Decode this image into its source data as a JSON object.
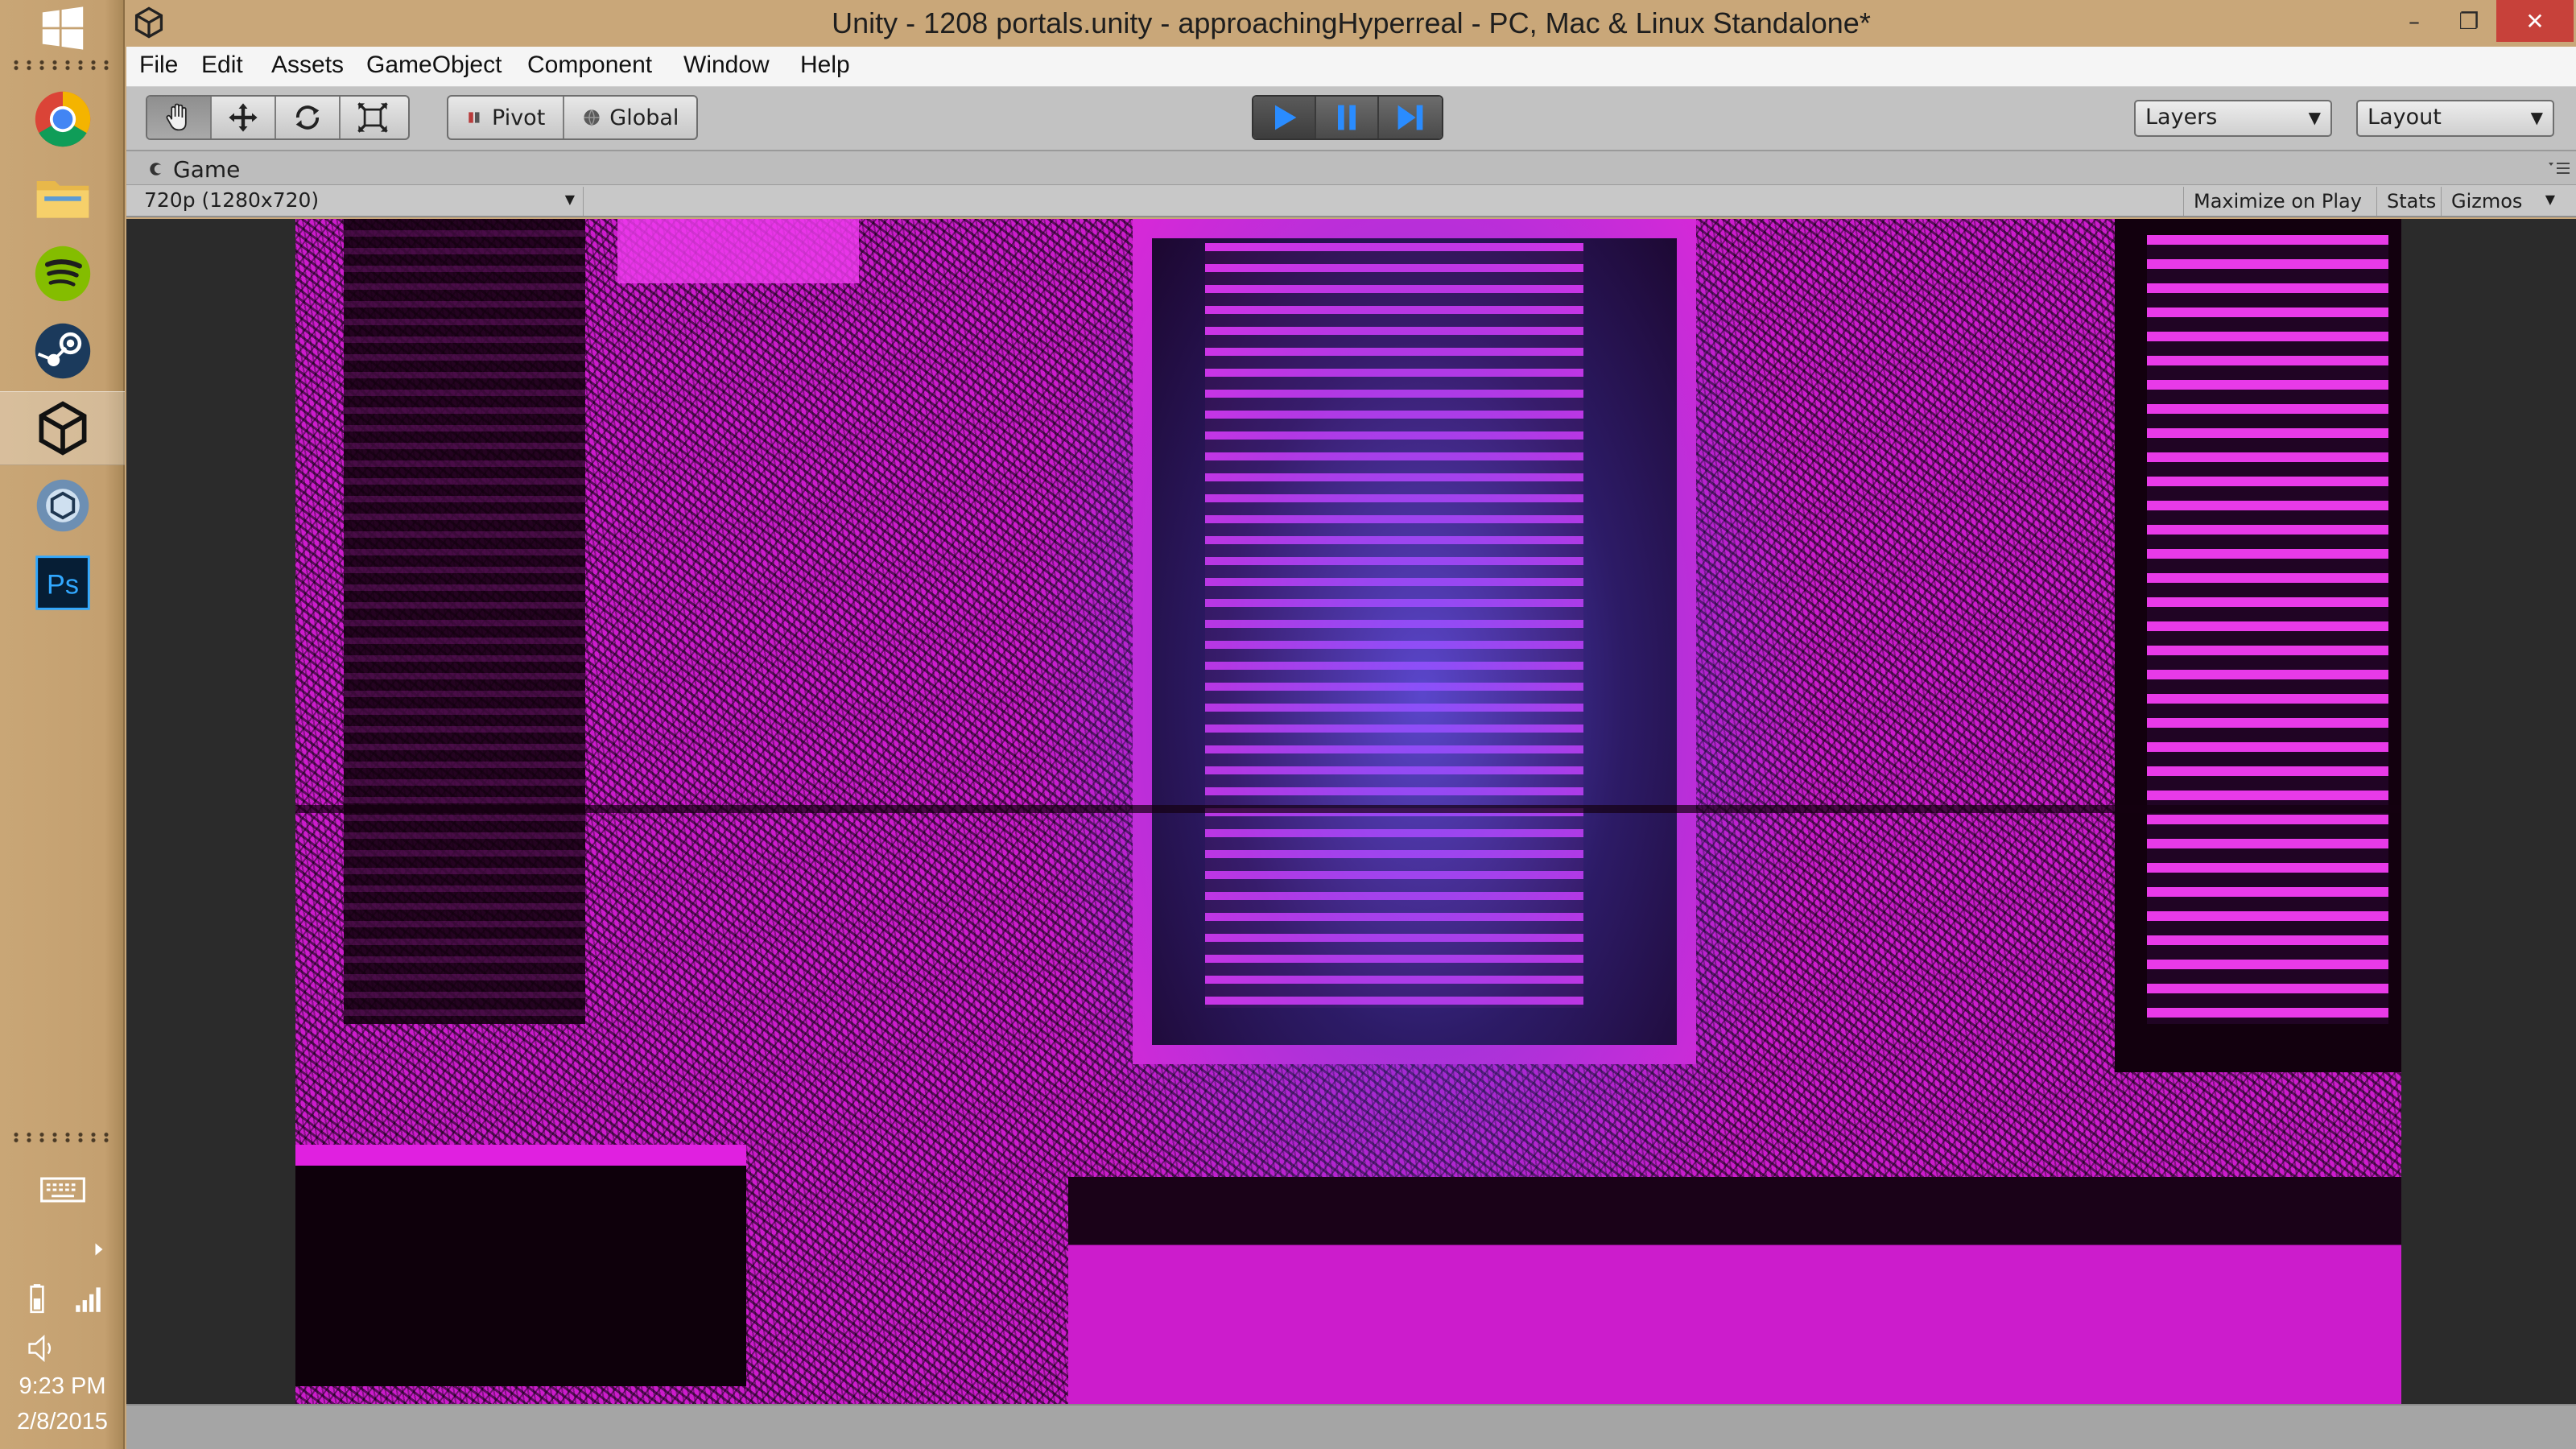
{
  "window": {
    "title": "Unity - 1208 portals.unity - approachingHyperreal - PC, Mac & Linux Standalone*",
    "controls": {
      "minimize": "–",
      "restore": "❐",
      "close": "✕"
    }
  },
  "menu": [
    "File",
    "Edit",
    "Assets",
    "GameObject",
    "Component",
    "Window",
    "Help"
  ],
  "toolbar": {
    "transform_tools": [
      {
        "icon": "hand-icon",
        "active": true
      },
      {
        "icon": "move-icon",
        "active": false
      },
      {
        "icon": "rotate-icon",
        "active": false
      },
      {
        "icon": "scale-icon",
        "active": false
      }
    ],
    "pivot_label": "Pivot",
    "global_label": "Global",
    "playback": [
      "play-icon",
      "pause-icon",
      "step-icon"
    ],
    "play_color": "#2a8cff",
    "layers_label": "Layers",
    "layout_label": "Layout"
  },
  "game_view": {
    "tab_label": "Game",
    "resolution": "720p (1280x720)",
    "maximize_label": "Maximize on Play",
    "stats_label": "Stats",
    "gizmos_label": "Gizmos",
    "scene_colors": {
      "magenta": "#e020e0",
      "dark": "#14000f",
      "glow": "#6a5cff"
    }
  },
  "taskbar": {
    "apps": [
      {
        "name": "Google Chrome",
        "icon": "chrome-icon"
      },
      {
        "name": "File Explorer",
        "icon": "folder-icon"
      },
      {
        "name": "Spotify",
        "icon": "spotify-icon"
      },
      {
        "name": "Steam",
        "icon": "steam-icon"
      },
      {
        "name": "Unity",
        "icon": "unity-icon",
        "active": true
      },
      {
        "name": "Unity Remote",
        "icon": "unity-remote-icon"
      },
      {
        "name": "Photoshop",
        "icon": "photoshop-icon",
        "label": "Ps"
      }
    ],
    "time": "9:23 PM",
    "date": "2/8/2015"
  }
}
